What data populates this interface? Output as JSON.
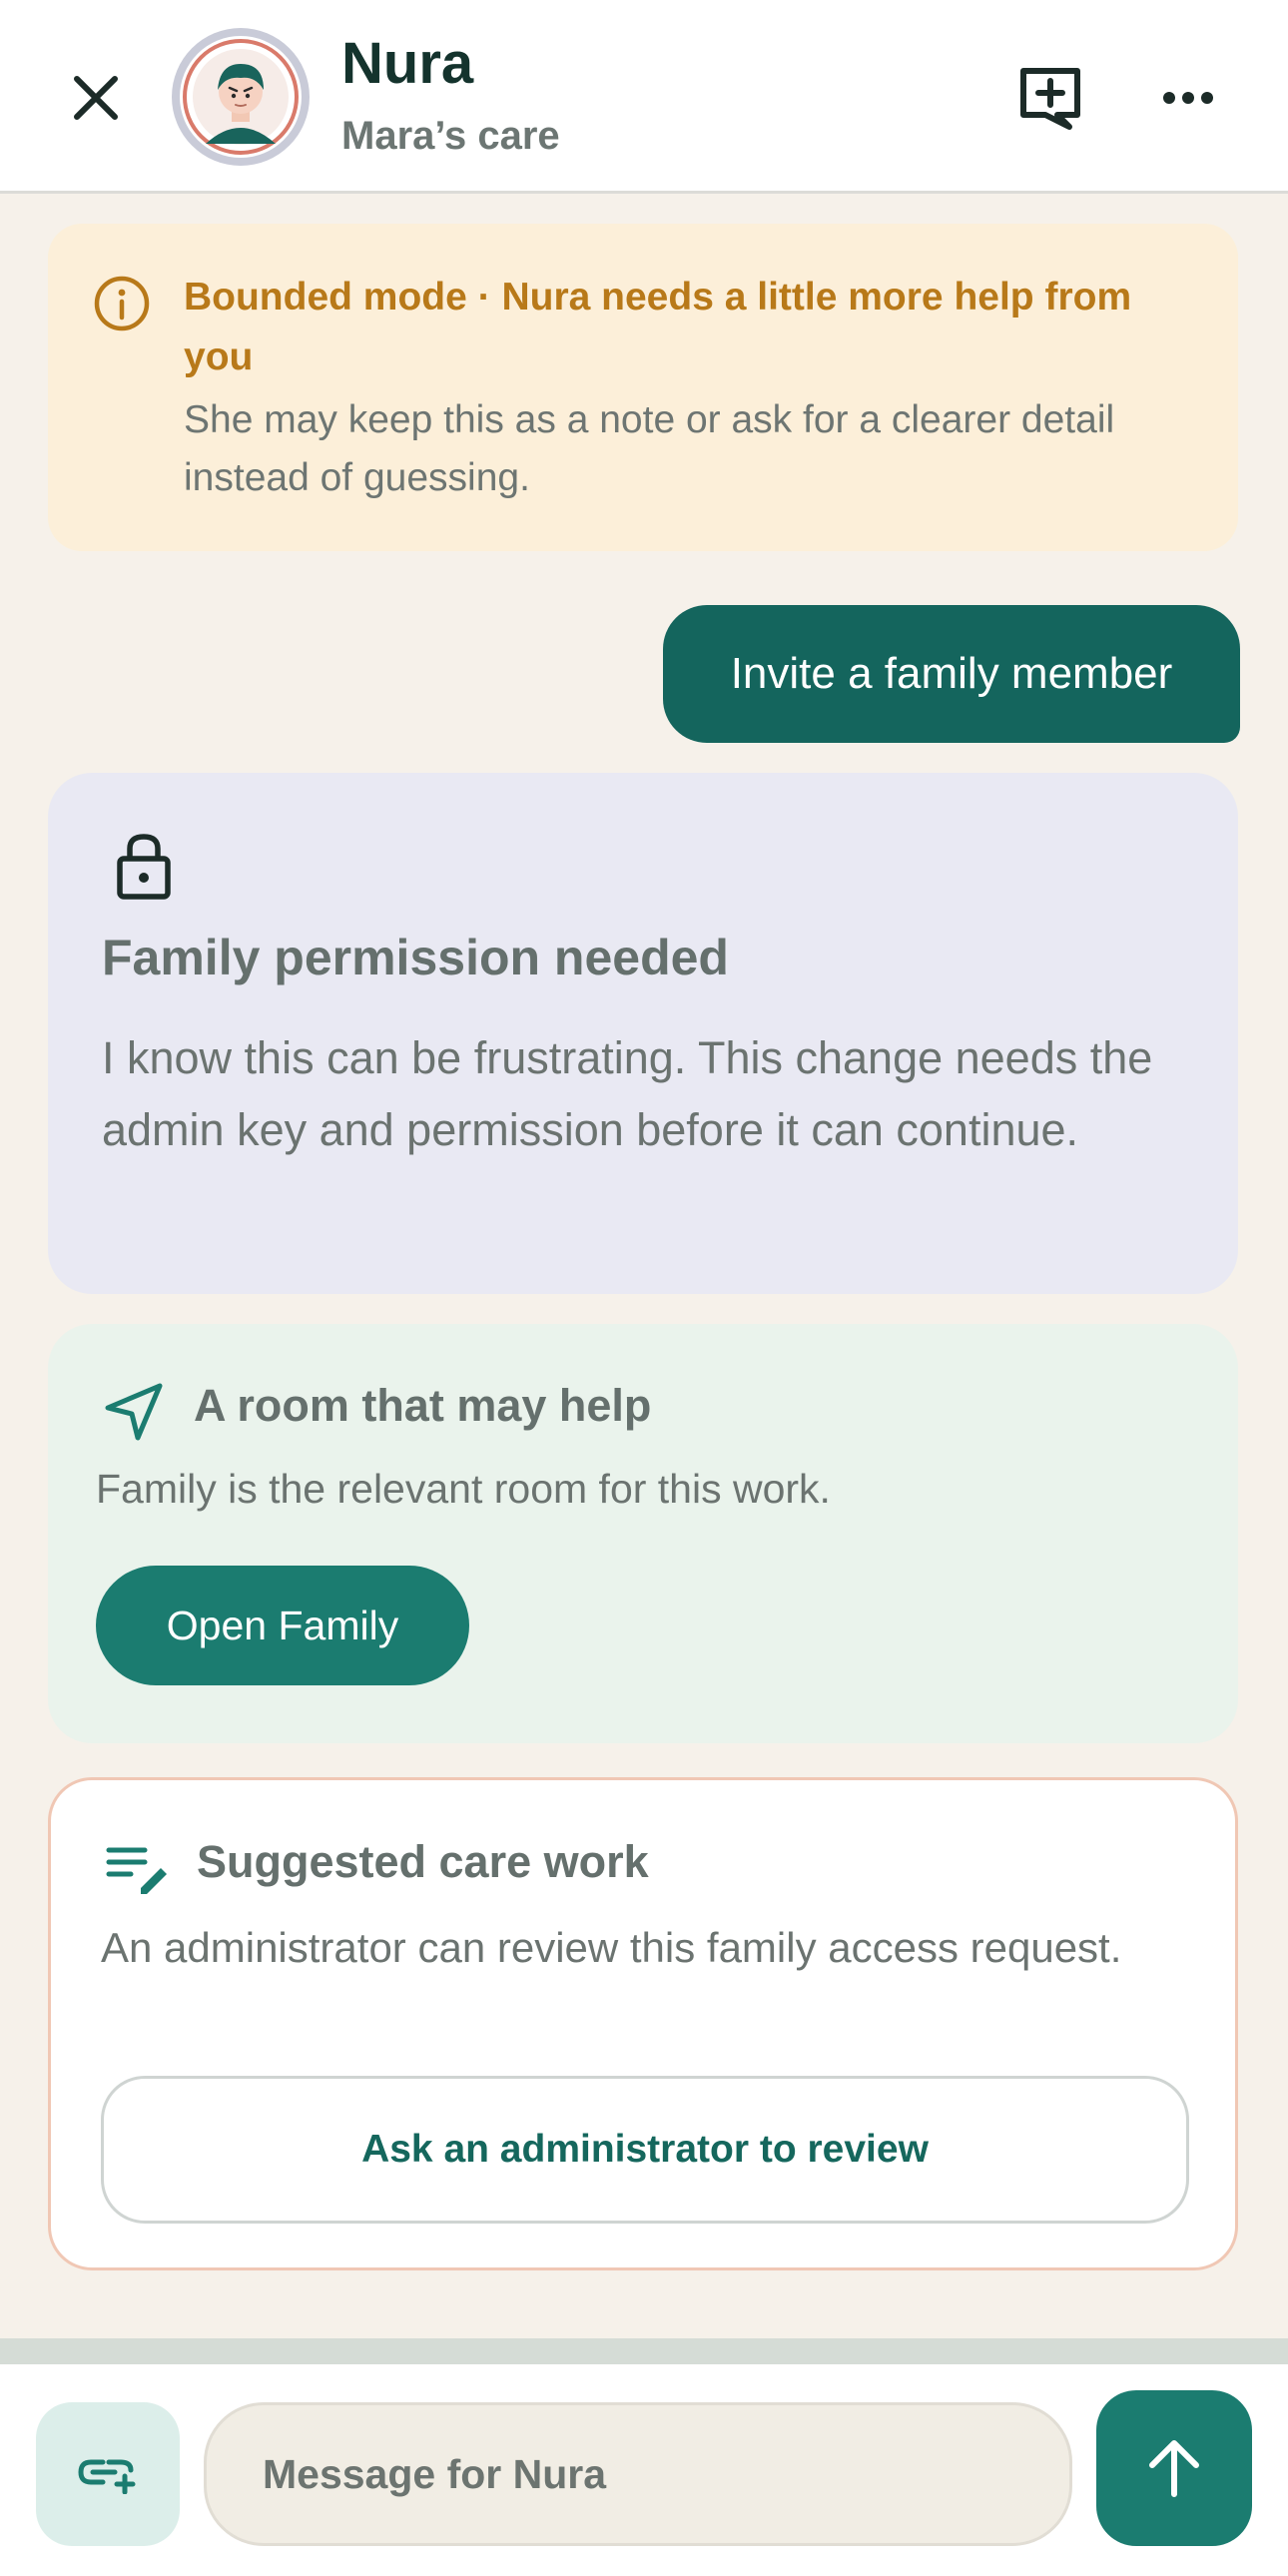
{
  "header": {
    "title": "Nura",
    "subtitle": "Mara’s care",
    "icons": [
      "close-icon",
      "avatar",
      "new-chat-icon",
      "more-icon"
    ]
  },
  "banner": {
    "title": "Bounded mode · Nura needs a little more help from you",
    "body": "She may keep this as a note or ask for a clearer detail instead of guessing.",
    "icon": "info-icon"
  },
  "conversation": {
    "user_message": "Invite a family member"
  },
  "permission_card": {
    "icon": "lock-icon",
    "title": "Family permission needed",
    "body": "I know this can be frustrating. This change needs the admin key and permission before it can continue."
  },
  "room_card": {
    "icon": "navigation-icon",
    "title": "A room that may help",
    "body": "Family is the relevant room for this work.",
    "button_label": "Open Family"
  },
  "suggestion_card": {
    "icon": "edit-note-icon",
    "title": "Suggested care work",
    "body": "An administrator can review this family access request.",
    "button_label": "Ask an administrator to review"
  },
  "composer": {
    "placeholder": "Message for Nura",
    "icons": [
      "attach-link-icon",
      "send-arrow-icon"
    ]
  },
  "colors": {
    "accent": "#1b7c70",
    "user_bubble": "#14655d",
    "banner_bg": "#fcefd9",
    "banner_text": "#b87919",
    "permission_bg": "#e9e9f3",
    "room_bg": "#eaf3ec",
    "page_bg": "#f6f1ea"
  }
}
